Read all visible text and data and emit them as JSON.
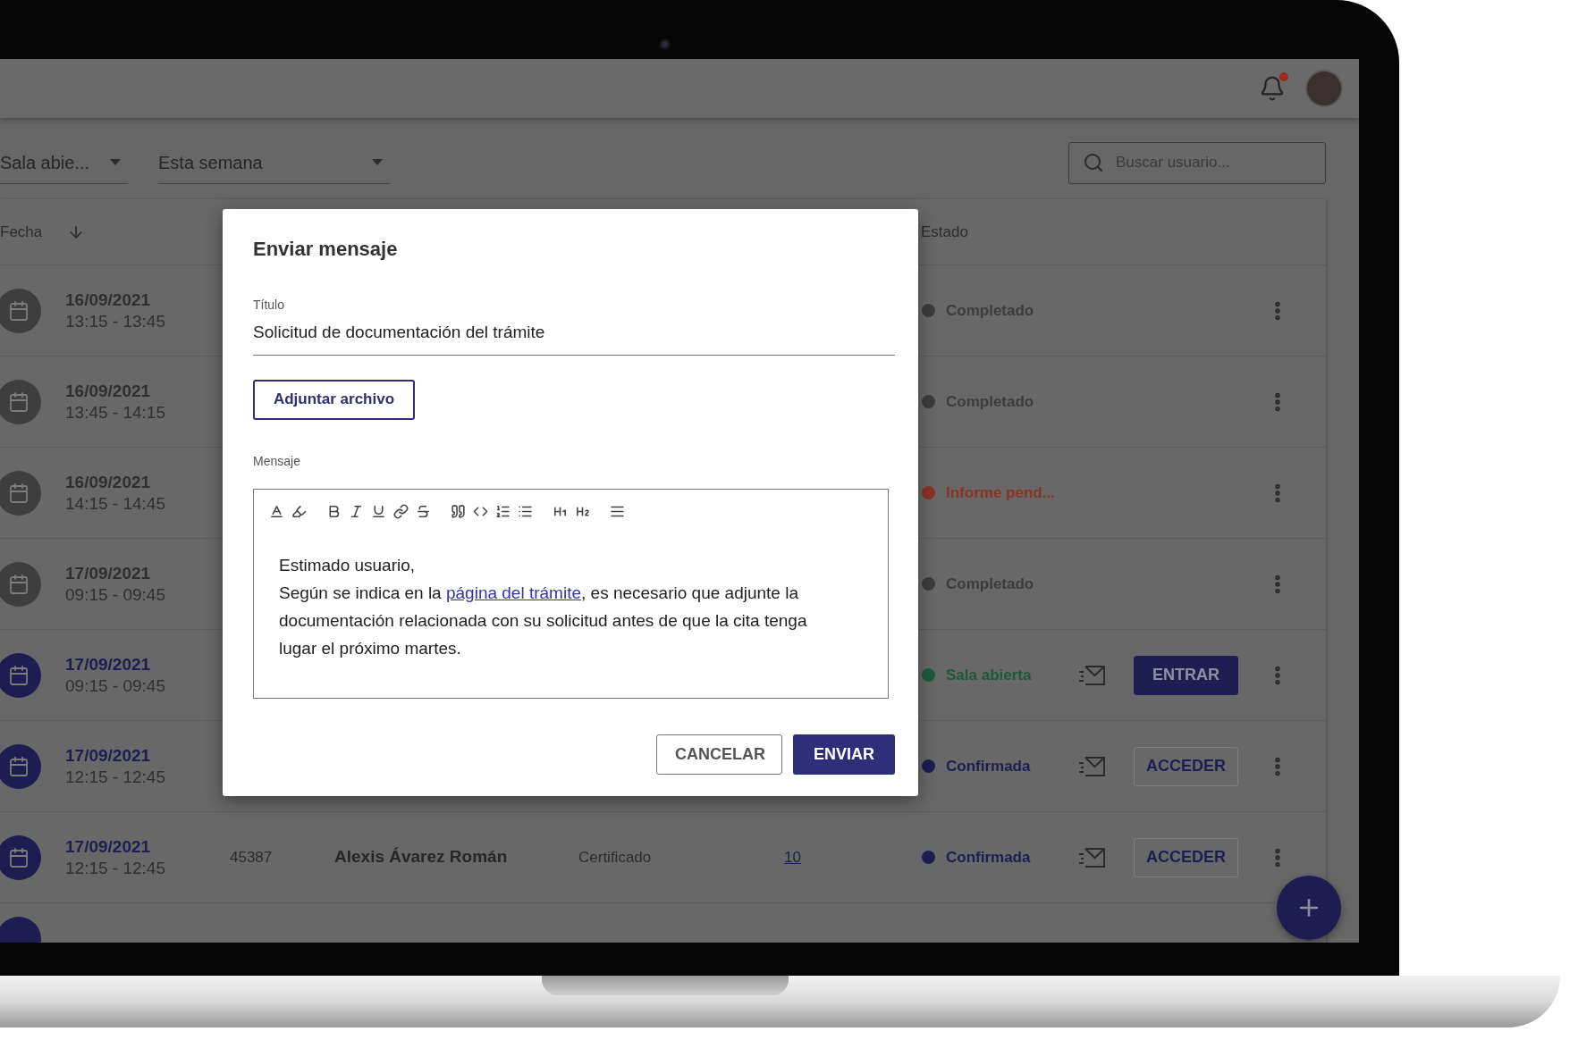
{
  "header": {
    "has_notification": true
  },
  "filters": [
    {
      "value": "Sala abie..."
    },
    {
      "value": "Esta semana"
    }
  ],
  "search": {
    "placeholder": "Buscar usuario..."
  },
  "table": {
    "columns": [
      {
        "label": "Fecha",
        "sorted": true
      },
      {
        "label": "Estado",
        "sorted": false
      }
    ],
    "rows": [
      {
        "date": "16/09/2021",
        "time": "13:15 - 13:45",
        "active": false,
        "status": "Completado",
        "color": "#3c3c3c",
        "message": false
      },
      {
        "date": "16/09/2021",
        "time": "13:45 - 14:15",
        "active": false,
        "status": "Completado",
        "color": "#3c3c3c",
        "message": false
      },
      {
        "date": "16/09/2021",
        "time": "14:15 - 14:45",
        "active": false,
        "status": "Informe pend...",
        "color": "#8a3226",
        "message": false
      },
      {
        "date": "17/09/2021",
        "time": "09:15 - 09:45",
        "active": false,
        "status": "Completado",
        "color": "#3c3c3c",
        "message": false
      },
      {
        "date": "17/09/2021",
        "time": "09:15 - 09:45",
        "active": true,
        "status": "Sala abierta",
        "color": "#1c5a3c",
        "message": true,
        "action": {
          "label": "ENTRAR",
          "kind": "filled"
        }
      },
      {
        "date": "17/09/2021",
        "time": "12:15 - 12:45",
        "active": true,
        "status": "Confirmada",
        "color": "#1e1d52",
        "message": true,
        "action": {
          "label": "ACCEDER",
          "kind": "outlined"
        }
      },
      {
        "date": "17/09/2021",
        "time": "12:15 - 12:45",
        "active": true,
        "id": "45387",
        "name": "Alexis Ávarez Román",
        "type": "Certificado",
        "count": "10",
        "status": "Confirmada",
        "color": "#1e1d52",
        "message": true,
        "action": {
          "label": "ACCEDER",
          "kind": "outlined"
        }
      }
    ]
  },
  "dialog": {
    "title": "Enviar mensaje",
    "field_label": "Título",
    "field_value": "Solicitud de documentación del trámite",
    "attach_button": "Adjuntar archivo",
    "message_label": "Mensaje",
    "message": {
      "greeting": "Estimado usuario,",
      "before_link": "Según se indica en la ",
      "link": "página del trámite",
      "after_link": ", es necesario que adjunte la documentación relacionada con su solicitud antes de que la cita tenga lugar el próximo martes."
    },
    "buttons": [
      {
        "label": "CANCELAR",
        "kind": "outlined"
      },
      {
        "label": "ENVIAR",
        "kind": "filled"
      }
    ]
  }
}
